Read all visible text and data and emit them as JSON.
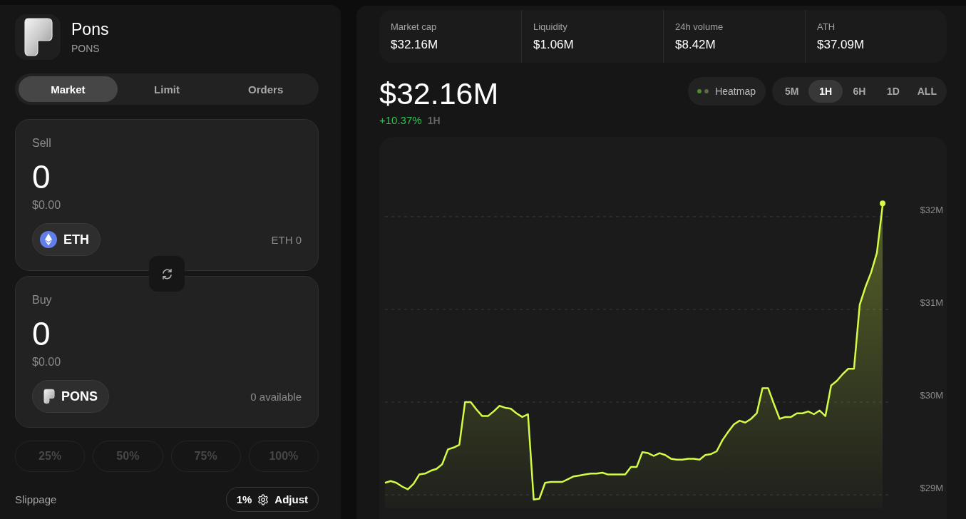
{
  "token": {
    "name": "Pons",
    "symbol": "PONS"
  },
  "order_tabs": [
    {
      "label": "Market",
      "selected": true
    },
    {
      "label": "Limit",
      "selected": false
    },
    {
      "label": "Orders",
      "selected": false
    }
  ],
  "swap_cards": [
    {
      "label": "Sell",
      "amount": "0",
      "usd_value": "$0.00",
      "token": "ETH",
      "balance": "ETH 0"
    },
    {
      "label": "Buy",
      "amount": "0",
      "usd_value": "$0.00",
      "token": "PONS",
      "balance": "0 available"
    }
  ],
  "percent_buttons": [
    {
      "label": "25%",
      "disabled": true
    },
    {
      "label": "50%",
      "disabled": true
    },
    {
      "label": "75%",
      "disabled": true
    },
    {
      "label": "100%",
      "disabled": true
    }
  ],
  "slippage": {
    "label": "Slippage",
    "value": "1%",
    "button_label": "Adjust"
  },
  "stats": [
    {
      "label": "Market cap",
      "value": "$32.16M"
    },
    {
      "label": "Liquidity",
      "value": "$1.06M"
    },
    {
      "label": "24h volume",
      "value": "$8.42M"
    },
    {
      "label": "ATH",
      "value": "$37.09M"
    }
  ],
  "price": {
    "value": "$32.16M",
    "change": "+10.37%",
    "period": "1H"
  },
  "heatmap_button": {
    "label": "Heatmap"
  },
  "time_ranges": [
    {
      "label": "5M",
      "selected": false
    },
    {
      "label": "1H",
      "selected": true
    },
    {
      "label": "6H",
      "selected": false
    },
    {
      "label": "1D",
      "selected": false
    },
    {
      "label": "ALL",
      "selected": false
    }
  ],
  "chart": {
    "chart_data": {
      "type": "area",
      "grid": true,
      "ylim": [
        28.74,
        32.86
      ],
      "yticks": [
        {
          "value": 32,
          "label": "$32M"
        },
        {
          "value": 31,
          "label": "$31M"
        },
        {
          "value": 30,
          "label": "$30M"
        },
        {
          "value": 29,
          "label": "$29M"
        }
      ],
      "values": [
        29.13,
        29.15,
        29.13,
        29.09,
        29.06,
        29.12,
        29.22,
        29.23,
        29.26,
        29.28,
        29.33,
        29.49,
        29.51,
        29.54,
        30.0,
        30.0,
        29.92,
        29.85,
        29.85,
        29.9,
        29.96,
        29.94,
        29.93,
        29.88,
        29.84,
        29.87,
        28.95,
        28.96,
        29.13,
        29.14,
        29.14,
        29.14,
        29.17,
        29.2,
        29.21,
        29.22,
        29.23,
        29.23,
        29.24,
        29.22,
        29.22,
        29.22,
        29.22,
        29.3,
        29.3,
        29.46,
        29.45,
        29.42,
        29.45,
        29.43,
        29.39,
        29.38,
        29.38,
        29.39,
        29.39,
        29.38,
        29.43,
        29.44,
        29.47,
        29.59,
        29.68,
        29.76,
        29.8,
        29.78,
        29.82,
        29.88,
        30.15,
        30.15,
        29.98,
        29.82,
        29.84,
        29.84,
        29.88,
        29.88,
        29.9,
        29.87,
        29.91,
        29.85,
        30.18,
        30.23,
        30.3,
        30.36,
        30.36,
        31.05,
        31.24,
        31.4,
        31.61,
        32.12
      ]
    }
  }
}
